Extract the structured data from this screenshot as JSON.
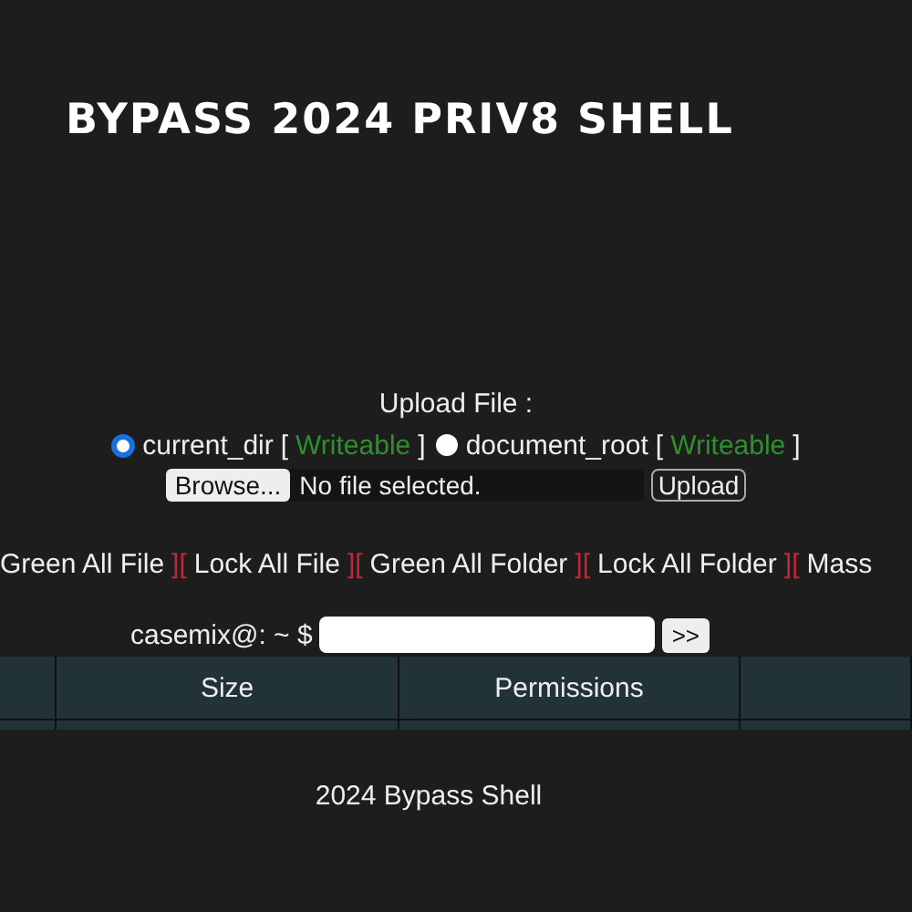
{
  "header": {
    "title": "BYPASS 2024 PRIV8 SHELL"
  },
  "upload": {
    "label": "Upload File :",
    "targets": [
      {
        "name": "current_dir",
        "open": "[",
        "status": "Writeable",
        "close": "]",
        "selected": true
      },
      {
        "name": "document_root",
        "open": "[",
        "status": "Writeable",
        "close": "]",
        "selected": false
      }
    ],
    "browse_button": "Browse...",
    "file_status": "No file selected.",
    "upload_button": "Upload"
  },
  "actions": [
    {
      "kind": "link",
      "text": "Green All File"
    },
    {
      "kind": "bracket",
      "text": "]["
    },
    {
      "kind": "link",
      "text": "Lock All File"
    },
    {
      "kind": "bracket",
      "text": "]["
    },
    {
      "kind": "link",
      "text": "Green All Folder"
    },
    {
      "kind": "bracket",
      "text": "]["
    },
    {
      "kind": "link",
      "text": "Lock All Folder"
    },
    {
      "kind": "bracket",
      "text": "]["
    },
    {
      "kind": "link",
      "text": "Mass"
    }
  ],
  "command": {
    "prompt": "casemix@: ~ $",
    "button": ">>"
  },
  "table": {
    "columns": [
      {
        "kind": "blank"
      },
      {
        "kind": "text",
        "label": "Size"
      },
      {
        "kind": "text",
        "label": "Permissions"
      },
      {
        "kind": "blank"
      }
    ]
  },
  "footer": {
    "text": "2024 Bypass Shell"
  }
}
